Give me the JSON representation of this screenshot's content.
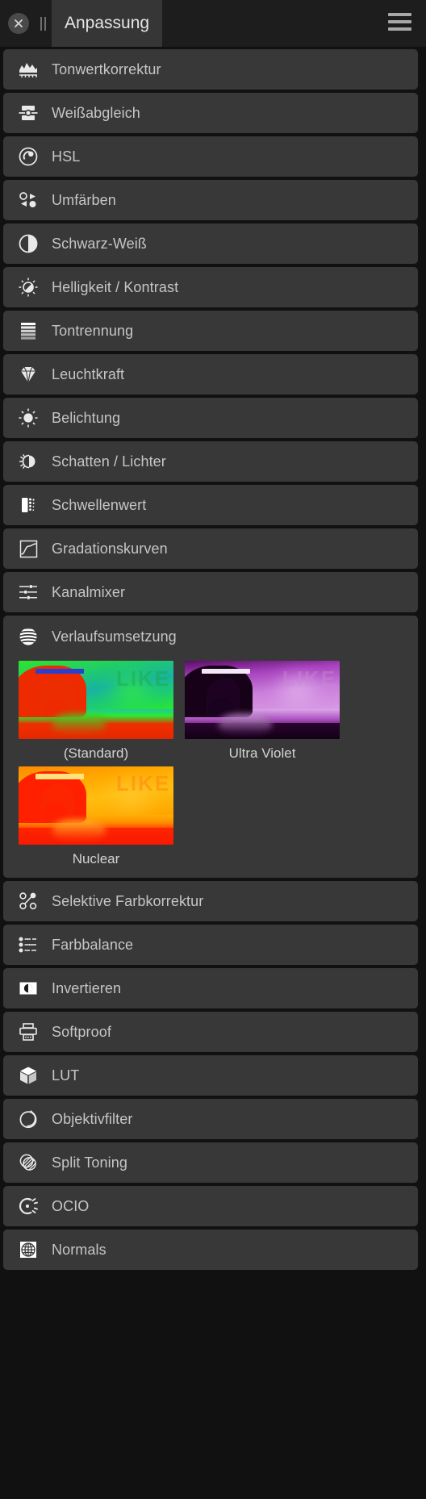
{
  "titlebar": {
    "close_icon": "close-circle-icon",
    "drag_handle_icon": "drag-handle-icon",
    "tab_label": "Anpassung",
    "menu_icon": "hamburger-menu-icon"
  },
  "colors": {
    "window_bg": "#111111",
    "titlebar_bg": "#1d1d1d",
    "tab_active_bg": "#363636",
    "row_bg": "#383838",
    "label_text": "#c6c6c6",
    "icon_color": "#e9e9e9"
  },
  "adjustments": [
    {
      "label": "Tonwertkorrektur",
      "icon": "levels-histogram-icon",
      "expanded": false
    },
    {
      "label": "Weißabgleich",
      "icon": "white-balance-icon",
      "expanded": false
    },
    {
      "label": "HSL",
      "icon": "hsl-color-wheel-icon",
      "expanded": false
    },
    {
      "label": "Umfärben",
      "icon": "recolor-icon",
      "expanded": false
    },
    {
      "label": "Schwarz-Weiß",
      "icon": "black-and-white-circle-icon",
      "expanded": false
    },
    {
      "label": "Helligkeit / Kontrast",
      "icon": "brightness-contrast-sun-icon",
      "expanded": false
    },
    {
      "label": "Tontrennung",
      "icon": "posterize-bands-icon",
      "expanded": false
    },
    {
      "label": "Leuchtkraft",
      "icon": "vibrance-gem-icon",
      "expanded": false
    },
    {
      "label": "Belichtung",
      "icon": "exposure-sun-icon",
      "expanded": false
    },
    {
      "label": "Schatten / Lichter",
      "icon": "shadows-highlights-icon",
      "expanded": false
    },
    {
      "label": "Schwellenwert",
      "icon": "threshold-icon",
      "expanded": false
    },
    {
      "label": "Gradationskurven",
      "icon": "curves-icon",
      "expanded": false
    },
    {
      "label": "Kanalmixer",
      "icon": "channel-mixer-sliders-icon",
      "expanded": false
    },
    {
      "label": "Verlaufsumsetzung",
      "icon": "gradient-map-sphere-icon",
      "expanded": true
    },
    {
      "label": "Selektive Farbkorrektur",
      "icon": "selective-color-icon",
      "expanded": false
    },
    {
      "label": "Farbbalance",
      "icon": "color-balance-sliders-icon",
      "expanded": false
    },
    {
      "label": "Invertieren",
      "icon": "invert-icon",
      "expanded": false
    },
    {
      "label": "Softproof",
      "icon": "printer-softproof-icon",
      "expanded": false
    },
    {
      "label": "LUT",
      "icon": "lut-cube-icon",
      "expanded": false
    },
    {
      "label": "Objektivfilter",
      "icon": "lens-filter-icon",
      "expanded": false
    },
    {
      "label": "Split Toning",
      "icon": "split-toning-icon",
      "expanded": false
    },
    {
      "label": "OCIO",
      "icon": "ocio-icon",
      "expanded": false
    },
    {
      "label": "Normals",
      "icon": "normals-globe-icon",
      "expanded": false
    }
  ],
  "gradient_map_presets": [
    {
      "name": "(Standard)",
      "sky_from": "#23d04a",
      "sky_to": "#1ba8a0",
      "land": "#ee2b00",
      "accent": "#19f02c",
      "banner": "#2b3ecf",
      "watermark": "#1fa840"
    },
    {
      "name": "Ultra Violet",
      "sky_from": "#2a0430",
      "sky_to": "#c86adc",
      "land": "#120114",
      "accent": "#b33fc8",
      "banner": "#f2e6f7",
      "watermark": "#b57bc4"
    },
    {
      "name": "Nuclear",
      "sky_from": "#ff9d00",
      "sky_to": "#ffb300",
      "land": "#ff1e00",
      "accent": "#ffd24a",
      "banner": "#ffe27a",
      "watermark": "#ff7a18"
    }
  ]
}
